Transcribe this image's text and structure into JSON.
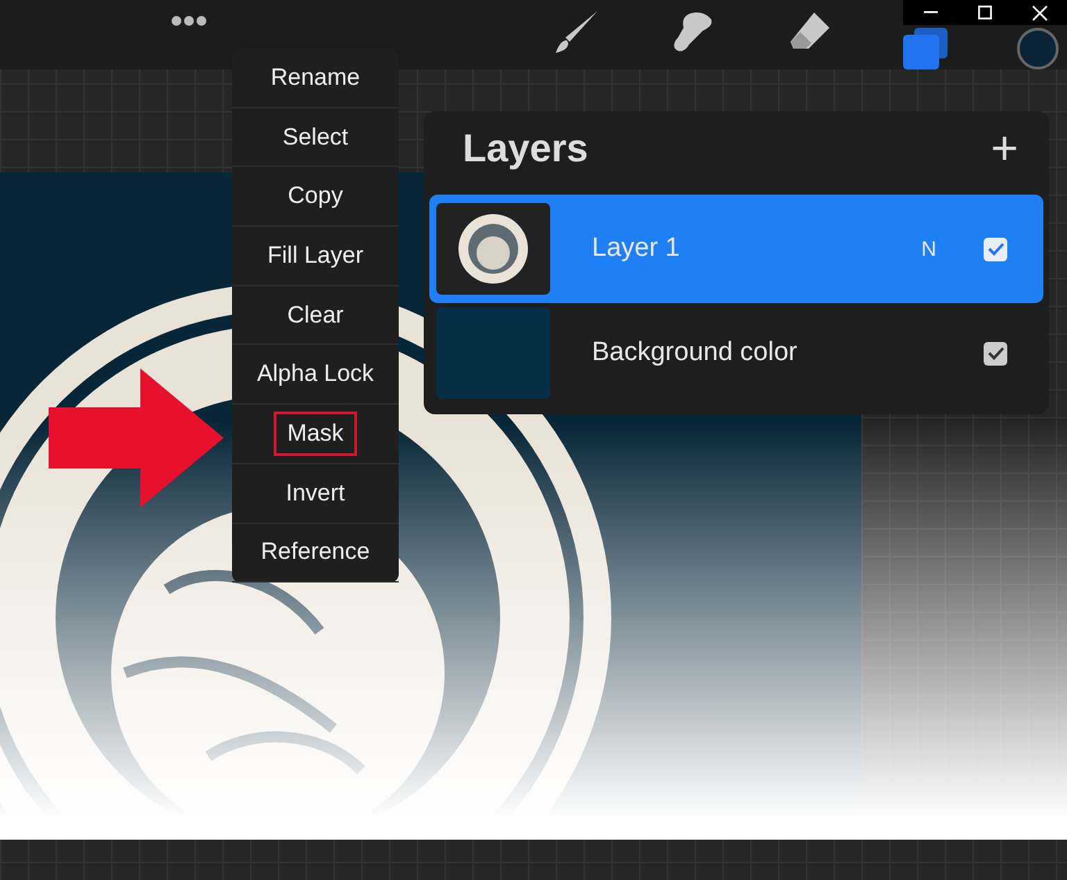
{
  "menu": {
    "items": [
      {
        "label": "Rename",
        "highlighted": false
      },
      {
        "label": "Select",
        "highlighted": false
      },
      {
        "label": "Copy",
        "highlighted": false
      },
      {
        "label": "Fill Layer",
        "highlighted": false
      },
      {
        "label": "Clear",
        "highlighted": false
      },
      {
        "label": "Alpha Lock",
        "highlighted": false
      },
      {
        "label": "Mask",
        "highlighted": true
      },
      {
        "label": "Invert",
        "highlighted": false
      },
      {
        "label": "Reference",
        "highlighted": false
      }
    ]
  },
  "layers_panel": {
    "title": "Layers",
    "add_button": "+",
    "layers": [
      {
        "name": "Layer 1",
        "kind": "image",
        "blend_mode": "N",
        "visible": true,
        "selected": true
      },
      {
        "name": "Background color",
        "kind": "color",
        "color": "#062e45",
        "visible": true,
        "selected": false
      }
    ]
  }
}
